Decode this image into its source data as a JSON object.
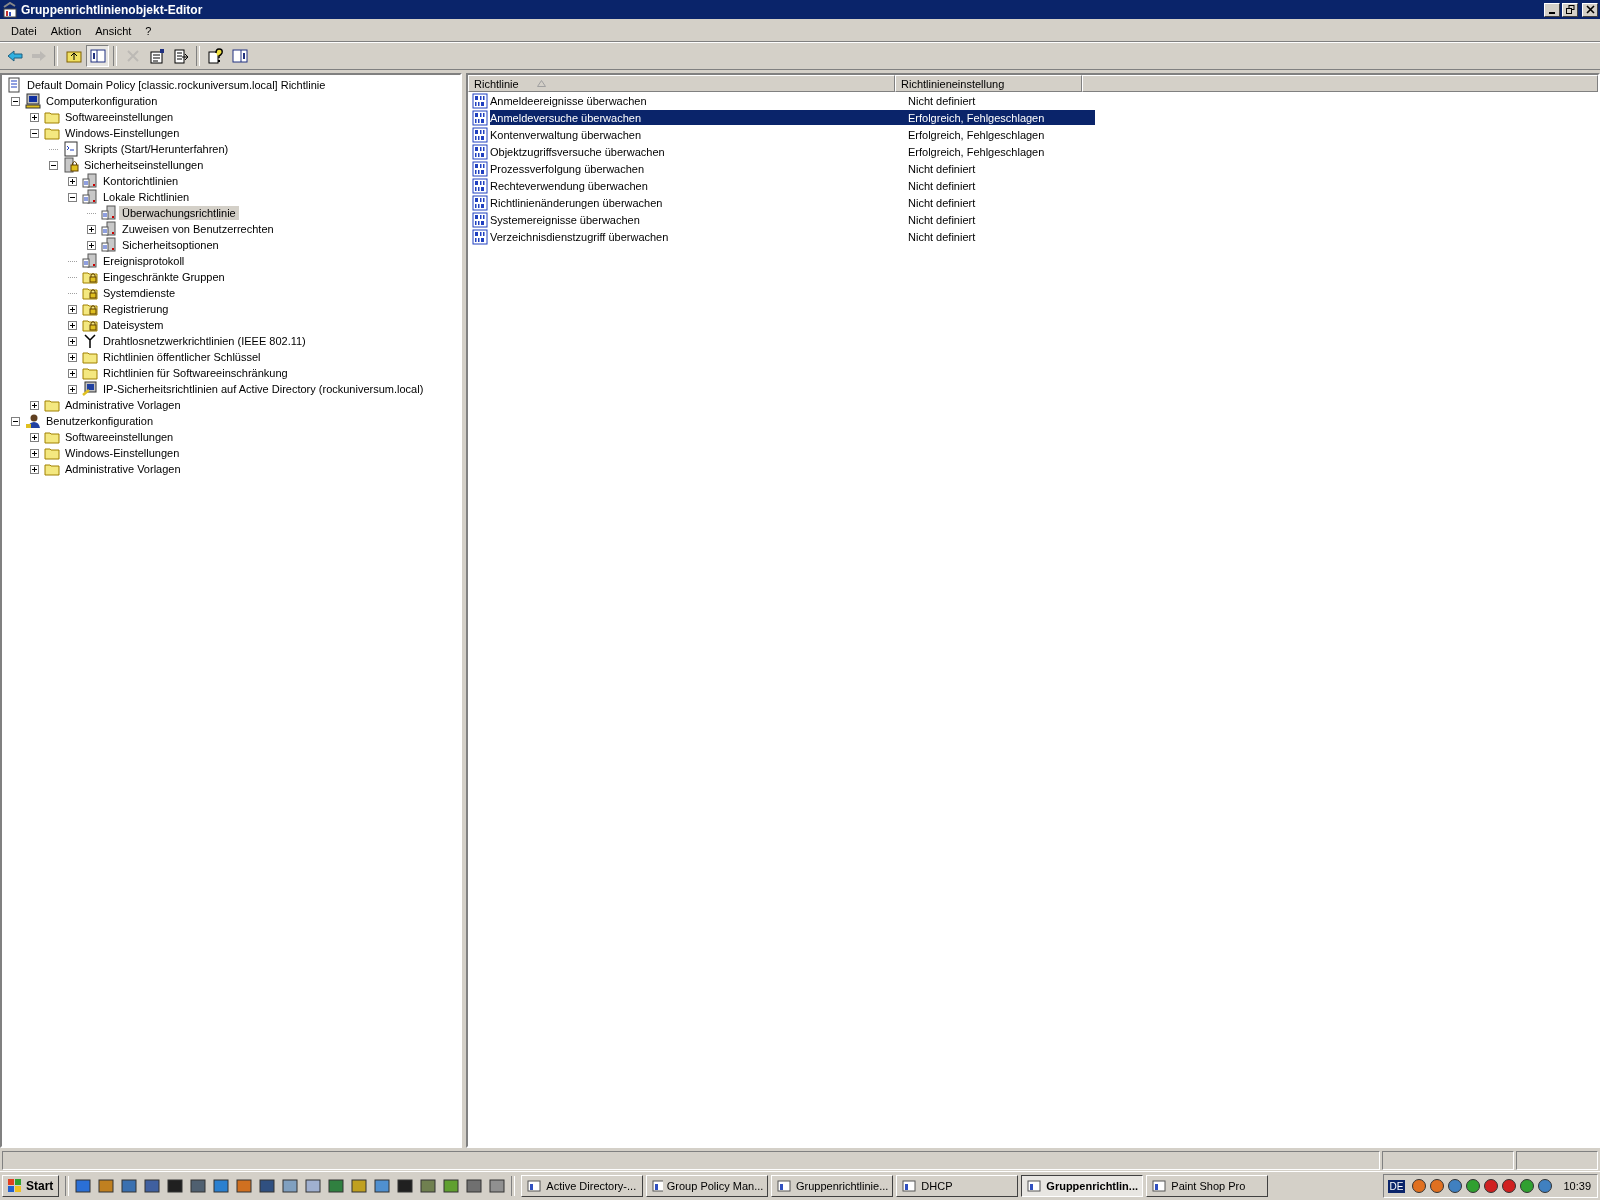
{
  "window": {
    "title": "Gruppenrichtlinienobjekt-Editor"
  },
  "menu": [
    "Datei",
    "Aktion",
    "Ansicht",
    "?"
  ],
  "toolbar": [
    {
      "kind": "back",
      "disabled": false,
      "pressed": false
    },
    {
      "kind": "forward",
      "disabled": true,
      "pressed": false
    },
    {
      "kind": "sep",
      "disabled": false,
      "pressed": false
    },
    {
      "kind": "up",
      "disabled": false,
      "pressed": false
    },
    {
      "kind": "tree",
      "disabled": false,
      "pressed": true
    },
    {
      "kind": "sep",
      "disabled": false,
      "pressed": false
    },
    {
      "kind": "delete",
      "disabled": true,
      "pressed": false
    },
    {
      "kind": "properties",
      "disabled": false,
      "pressed": false
    },
    {
      "kind": "export",
      "disabled": false,
      "pressed": false
    },
    {
      "kind": "sep",
      "disabled": false,
      "pressed": false
    },
    {
      "kind": "help",
      "disabled": false,
      "pressed": false
    },
    {
      "kind": "pane",
      "disabled": false,
      "pressed": false
    }
  ],
  "tree": [
    {
      "label": "Default Domain Policy [classic.rockuniversum.local] Richtlinie",
      "kind": "scroll",
      "selected": false,
      "children": [
        {
          "label": "Computerkonfiguration",
          "kind": "computer",
          "expandable": true,
          "expanded": true,
          "selected": false,
          "children": [
            {
              "label": "Softwareeinstellungen",
              "kind": "folder",
              "expandable": true,
              "expanded": false,
              "selected": false
            },
            {
              "label": "Windows-Einstellungen",
              "kind": "folder",
              "expandable": true,
              "expanded": true,
              "selected": false,
              "children": [
                {
                  "label": "Skripts (Start/Herunterfahren)",
                  "kind": "script",
                  "expandable": false,
                  "selected": false
                },
                {
                  "label": "Sicherheitseinstellungen",
                  "kind": "security",
                  "expandable": true,
                  "expanded": true,
                  "selected": false,
                  "children": [
                    {
                      "label": "Kontorichtlinien",
                      "kind": "policy",
                      "expandable": true,
                      "expanded": false,
                      "selected": false
                    },
                    {
                      "label": "Lokale Richtlinien",
                      "kind": "policy",
                      "expandable": true,
                      "expanded": true,
                      "selected": false,
                      "children": [
                        {
                          "label": "Überwachungsrichtlinie",
                          "kind": "policy",
                          "expandable": false,
                          "selected": true
                        },
                        {
                          "label": "Zuweisen von Benutzerrechten",
                          "kind": "policy",
                          "expandable": true,
                          "expanded": false,
                          "selected": false
                        },
                        {
                          "label": "Sicherheitsoptionen",
                          "kind": "policy",
                          "expandable": true,
                          "expanded": false,
                          "selected": false
                        }
                      ]
                    },
                    {
                      "label": "Ereignisprotokoll",
                      "kind": "policy",
                      "expandable": false,
                      "selected": false
                    },
                    {
                      "label": "Eingeschränkte Gruppen",
                      "kind": "lockfolder",
                      "expandable": false,
                      "selected": false
                    },
                    {
                      "label": "Systemdienste",
                      "kind": "lockfolder",
                      "expandable": false,
                      "selected": false
                    },
                    {
                      "label": "Registrierung",
                      "kind": "lockfolder",
                      "expandable": true,
                      "expanded": false,
                      "selected": false
                    },
                    {
                      "label": "Dateisystem",
                      "kind": "lockfolder",
                      "expandable": true,
                      "expanded": false,
                      "selected": false
                    },
                    {
                      "label": "Drahtlosnetzwerkrichtlinien (IEEE 802.11)",
                      "kind": "antenna",
                      "expandable": true,
                      "expanded": false,
                      "selected": false
                    },
                    {
                      "label": "Richtlinien öffentlicher Schlüssel",
                      "kind": "folder",
                      "expandable": true,
                      "expanded": false,
                      "selected": false
                    },
                    {
                      "label": "Richtlinien für Softwareeinschränkung",
                      "kind": "folder",
                      "expandable": true,
                      "expanded": false,
                      "selected": false
                    },
                    {
                      "label": "IP-Sicherheitsrichtlinien auf Active Directory (rockuniversum.local)",
                      "kind": "ipsec",
                      "expandable": true,
                      "expanded": false,
                      "selected": false
                    }
                  ]
                }
              ]
            },
            {
              "label": "Administrative Vorlagen",
              "kind": "folder",
              "expandable": true,
              "expanded": false,
              "selected": false
            }
          ]
        },
        {
          "label": "Benutzerkonfiguration",
          "kind": "user",
          "expandable": true,
          "expanded": true,
          "selected": false,
          "children": [
            {
              "label": "Softwareeinstellungen",
              "kind": "folder",
              "expandable": true,
              "expanded": false,
              "selected": false
            },
            {
              "label": "Windows-Einstellungen",
              "kind": "folder",
              "expandable": true,
              "expanded": false,
              "selected": false
            },
            {
              "label": "Administrative Vorlagen",
              "kind": "folder",
              "expandable": true,
              "expanded": false,
              "selected": false
            }
          ]
        }
      ]
    }
  ],
  "table": {
    "columns": [
      "Richtlinie",
      "Richtlinieneinstellung"
    ],
    "rows": [
      {
        "policy": "Anmeldeereignisse überwachen",
        "setting": "Nicht definiert",
        "selected": false
      },
      {
        "policy": "Anmeldeversuche überwachen",
        "setting": "Erfolgreich, Fehlgeschlagen",
        "selected": true
      },
      {
        "policy": "Kontenverwaltung überwachen",
        "setting": "Erfolgreich, Fehlgeschlagen",
        "selected": false
      },
      {
        "policy": "Objektzugriffsversuche überwachen",
        "setting": "Erfolgreich, Fehlgeschlagen",
        "selected": false
      },
      {
        "policy": "Prozessverfolgung überwachen",
        "setting": "Nicht definiert",
        "selected": false
      },
      {
        "policy": "Rechteverwendung überwachen",
        "setting": "Nicht definiert",
        "selected": false
      },
      {
        "policy": "Richtlinienänderungen überwachen",
        "setting": "Nicht definiert",
        "selected": false
      },
      {
        "policy": "Systemereignisse überwachen",
        "setting": "Nicht definiert",
        "selected": false
      },
      {
        "policy": "Verzeichnisdienstzugriff überwachen",
        "setting": "Nicht definiert",
        "selected": false
      }
    ]
  },
  "taskbar": {
    "start": "Start",
    "windows": [
      {
        "label": "Active Directory-...",
        "selected": false
      },
      {
        "label": "Group Policy Man...",
        "selected": false
      },
      {
        "label": "Gruppenrichtlinie...",
        "selected": false
      },
      {
        "label": "DHCP",
        "selected": false
      },
      {
        "label": "Gruppenrichtlin...",
        "selected": true
      },
      {
        "label": "Paint Shop Pro",
        "selected": false
      }
    ],
    "language": "DE",
    "clock": "10:39"
  }
}
